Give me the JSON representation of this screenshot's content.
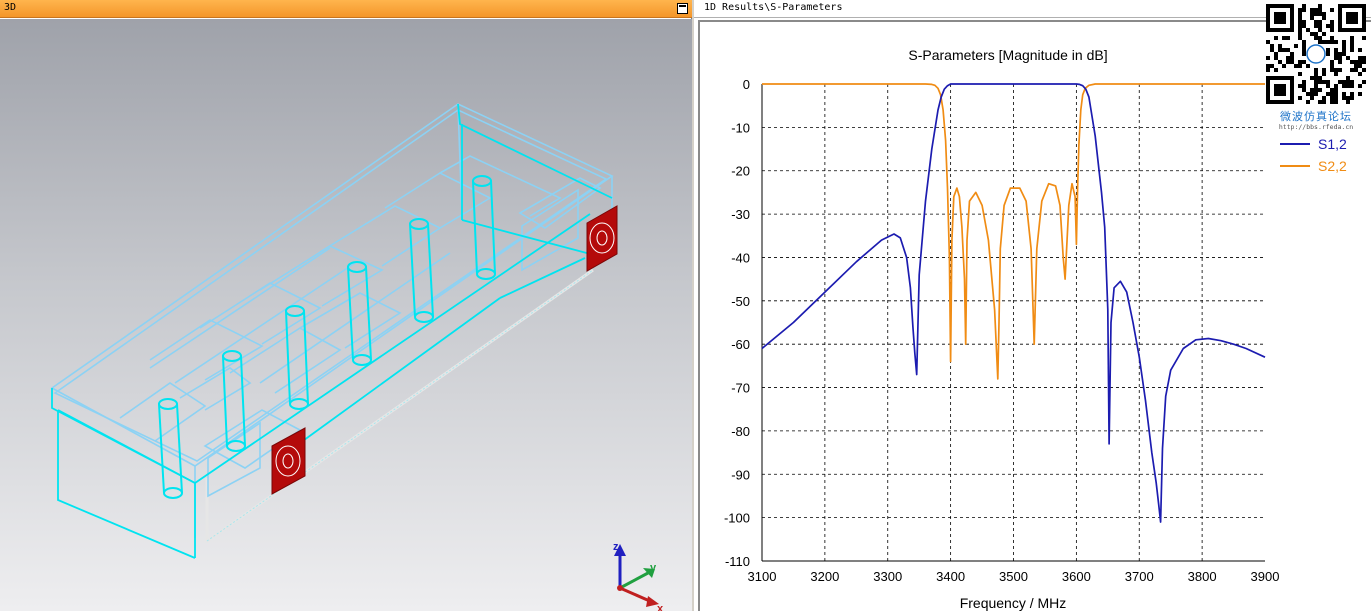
{
  "window_3d": {
    "title": "3D"
  },
  "window_1d": {
    "title": "1D Results\\S-Parameters"
  },
  "axes_triad": {
    "x": "x",
    "y": "y",
    "z": "z"
  },
  "watermark": {
    "name": "微波仿真论坛",
    "url": "http://bbs.rfeda.cn"
  },
  "colors": {
    "s12": "#1c1cb0",
    "s22": "#f08c14",
    "wireframe_light": "#8cd2f4",
    "wireframe_bright": "#00e4f0",
    "port": "#b40a0a",
    "titlebar": "#f4962a"
  },
  "icons": [
    "maximize-icon",
    "qr-code-icon",
    "axis-triad-icon",
    "port-icon"
  ],
  "chart_data": {
    "type": "line",
    "title": "S-Parameters [Magnitude in dB]",
    "xlabel": "Frequency / MHz",
    "ylabel": "",
    "xlim": [
      3100,
      3900
    ],
    "ylim": [
      -110,
      0
    ],
    "xticks": [
      "3100",
      "3200",
      "3300",
      "3400",
      "3500",
      "3600",
      "3700",
      "3800",
      "3900"
    ],
    "yticks": [
      "0",
      "-10",
      "-20",
      "-30",
      "-40",
      "-50",
      "-60",
      "-70",
      "-80",
      "-90",
      "-100",
      "-110"
    ],
    "grid": true,
    "legend_position": "top-right",
    "series": [
      {
        "name": "S1,2",
        "color": "#1c1cb0",
        "x": [
          3100,
          3150,
          3200,
          3250,
          3290,
          3310,
          3320,
          3330,
          3336,
          3340,
          3343,
          3346,
          3350,
          3360,
          3370,
          3380,
          3385,
          3390,
          3395,
          3400,
          3410,
          3450,
          3500,
          3550,
          3590,
          3600,
          3605,
          3610,
          3615,
          3620,
          3630,
          3640,
          3645,
          3650,
          3652,
          3655,
          3660,
          3670,
          3680,
          3690,
          3700,
          3710,
          3720,
          3727,
          3731,
          3734,
          3737,
          3742,
          3750,
          3770,
          3790,
          3810,
          3830,
          3850,
          3870,
          3900
        ],
        "y": [
          -61,
          -55,
          -48,
          -41,
          -36,
          -34.6,
          -35.5,
          -40,
          -47,
          -56,
          -62,
          -67,
          -44,
          -27,
          -15,
          -6,
          -3,
          -1.2,
          -0.4,
          0,
          0,
          0,
          0,
          0,
          0,
          0,
          -0.1,
          -0.4,
          -1.2,
          -3,
          -12,
          -25,
          -33,
          -52,
          -83,
          -55,
          -47,
          -45.5,
          -48,
          -55,
          -63,
          -73,
          -85,
          -92,
          -97,
          -101,
          -84,
          -72,
          -66,
          -61,
          -59,
          -58.7,
          -59.2,
          -60,
          -61,
          -63
        ]
      },
      {
        "name": "S2,2",
        "color": "#f08c14",
        "x": [
          3100,
          3360,
          3370,
          3375,
          3380,
          3384,
          3388,
          3392,
          3395,
          3398,
          3400,
          3402,
          3405,
          3410,
          3414,
          3418,
          3422,
          3424,
          3426,
          3430,
          3440,
          3450,
          3460,
          3470,
          3475,
          3477,
          3479,
          3485,
          3495,
          3510,
          3520,
          3528,
          3533,
          3537,
          3545,
          3556,
          3567,
          3574,
          3579,
          3582,
          3588,
          3593,
          3598,
          3600,
          3602,
          3604,
          3607,
          3610,
          3614,
          3620,
          3630,
          3900
        ],
        "y": [
          0,
          0,
          -0.1,
          -0.3,
          -1,
          -2.5,
          -6,
          -13,
          -24,
          -40,
          -64,
          -36,
          -26,
          -24,
          -26,
          -33,
          -45,
          -60,
          -36,
          -27,
          -25,
          -28,
          -36,
          -52,
          -68,
          -55,
          -38,
          -28,
          -24,
          -24,
          -27,
          -38,
          -60,
          -38,
          -27,
          -23,
          -23.5,
          -28,
          -40,
          -45,
          -28,
          -23,
          -26,
          -37,
          -24,
          -14,
          -6,
          -2.5,
          -1,
          -0.3,
          0,
          0
        ]
      }
    ]
  }
}
